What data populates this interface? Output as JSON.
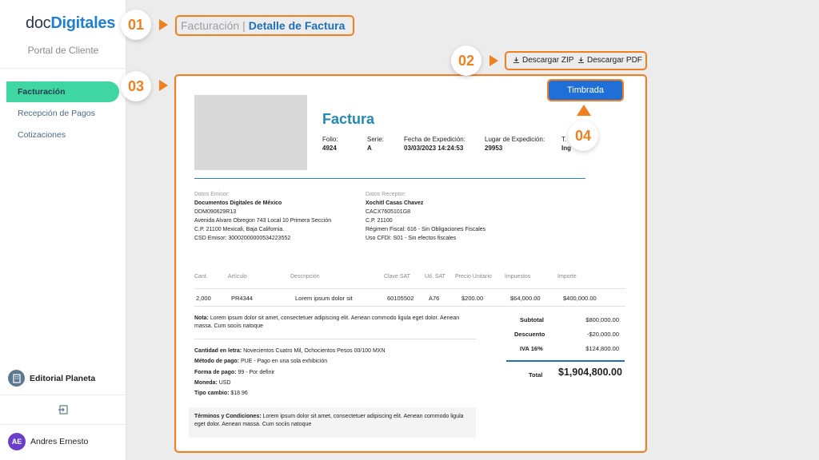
{
  "sidebar": {
    "logo_part1": "doc",
    "logo_part2": "Digitales",
    "portal_label": "Portal de Cliente",
    "items": [
      {
        "label": "Facturación"
      },
      {
        "label": "Recepción de Pagos"
      },
      {
        "label": "Cotizaciones"
      }
    ],
    "org_name": "Editorial Planeta",
    "user_initials": "AE",
    "user_name": "Andres Ernesto"
  },
  "breadcrumb": {
    "parent": "Facturación",
    "separator": "|",
    "current": "Detalle de Factura"
  },
  "downloads": {
    "zip": "Descargar ZIP",
    "pdf": "Descargar PDF"
  },
  "callouts": {
    "c1": "01",
    "c2": "02",
    "c3": "03",
    "c4": "04"
  },
  "invoice": {
    "status": "Timbrada",
    "title": "Factura",
    "meta": [
      {
        "label": "Folio:",
        "value": "4924"
      },
      {
        "label": "Serie:",
        "value": "A"
      },
      {
        "label": "Fecha de Expedición:",
        "value": "03/03/2023 14:24:53"
      },
      {
        "label": "Lugar de Expedición:",
        "value": "29953"
      },
      {
        "label": "T.",
        "value": "Ing"
      }
    ],
    "emisor": {
      "heading": "Datos Emisor:",
      "name": "Documentos Digitales de México",
      "rfc": "DDM090629R13",
      "address": "Avenida Alvaro Obregon 743 Local 10 Primera Sección",
      "city": "C.P. 21100 Mexicali, Baja California.",
      "csd": "CSD Emisor: 30002000000534223552"
    },
    "receptor": {
      "heading": "Datos Receptor:",
      "name": "Xochitl Casas Chavez",
      "rfc": "CACX7605101G8",
      "cp": "C.P. 21100",
      "regimen": "Régimen Fiscal: 616 - Sin Obligaciones Fiscales",
      "uso": "Uso CFDI: S01 - Sin efectos fiscales"
    },
    "table_headers": [
      "Cant.",
      "Artículo",
      "Descripción",
      "Clave SAT",
      "Ud. SAT",
      "Precio Unitario",
      "Impuestos",
      "Importe"
    ],
    "rows": [
      [
        "2,000",
        "PR4344",
        "Lorem ipsum dolor sit",
        "60105502",
        "A76",
        "$200.00",
        "$64,000.00",
        "$400,000.00"
      ]
    ],
    "note_label": "Nota:",
    "note_text": "Lorem ipsum dolor sit amet, consectetuer adipiscing elit. Aenean commodo ligula eget dolor. Aenean massa. Cum sociis natoque",
    "subtotal_label": "Subtotal",
    "subtotal": "$800,000.00",
    "discount_label": "Descuento",
    "discount": "-$20,000.00",
    "iva_label": "IVA 16%",
    "iva": "$124,800.00",
    "total_label": "Total",
    "total": "$1,904,800.00",
    "details": [
      {
        "label": "Cantidad en letra:",
        "value": "Novecientos Cuatro Mil, Ochocientos Pesos 00/100 MXN"
      },
      {
        "label": "Método de pago:",
        "value": "PUE - Pago en una sola exhibición"
      },
      {
        "label": "Forma de pago:",
        "value": "99 - Por definir"
      },
      {
        "label": "Moneda:",
        "value": "USD"
      },
      {
        "label": "Tipo cambio:",
        "value": "$18.96"
      }
    ],
    "terms_label": "Términos y Condiciones:",
    "terms_text": "Lorem ipsum dolor sit amet, consectetuer adipiscing elit. Aenean commodo ligula eget dolor. Aenean massa. Cum sociis natoque"
  },
  "colors": {
    "accent": "#f07f1f",
    "active_nav": "#3fd6a4",
    "brand_blue": "#1f6fd6"
  }
}
